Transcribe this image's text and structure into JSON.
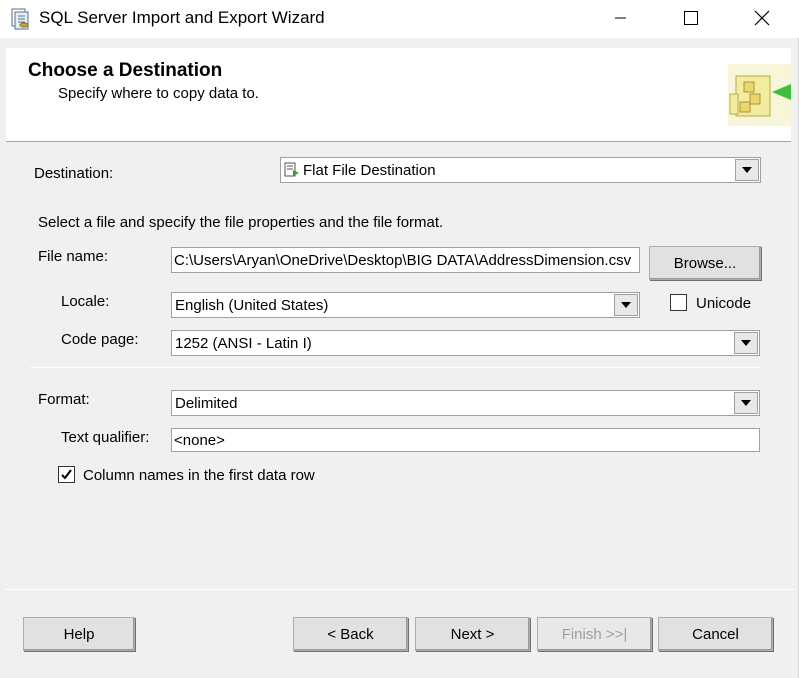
{
  "window": {
    "title": "SQL Server Import and Export Wizard"
  },
  "header": {
    "title": "Choose a Destination",
    "subtitle": "Specify where to copy data to."
  },
  "destination": {
    "label": "Destination:",
    "value": "Flat File Destination"
  },
  "instructions": "Select a file and specify the file properties and the file format.",
  "file_name": {
    "label": "File name:",
    "value": "C:\\Users\\Aryan\\OneDrive\\Desktop\\BIG DATA\\AddressDimension.csv",
    "browse_label": "Browse..."
  },
  "locale": {
    "label": "Locale:",
    "value": "English (United States)"
  },
  "unicode": {
    "label": "Unicode",
    "checked": false
  },
  "code_page": {
    "label": "Code page:",
    "value": "1252  (ANSI - Latin I)"
  },
  "format": {
    "label": "Format:",
    "value": "Delimited"
  },
  "text_qualifier": {
    "label": "Text qualifier:",
    "value": "<none>"
  },
  "column_names": {
    "label": "Column names in the first data row",
    "checked": true
  },
  "buttons": {
    "help": "Help",
    "back": "< Back",
    "next": "Next >",
    "finish": "Finish >>|",
    "cancel": "Cancel"
  }
}
